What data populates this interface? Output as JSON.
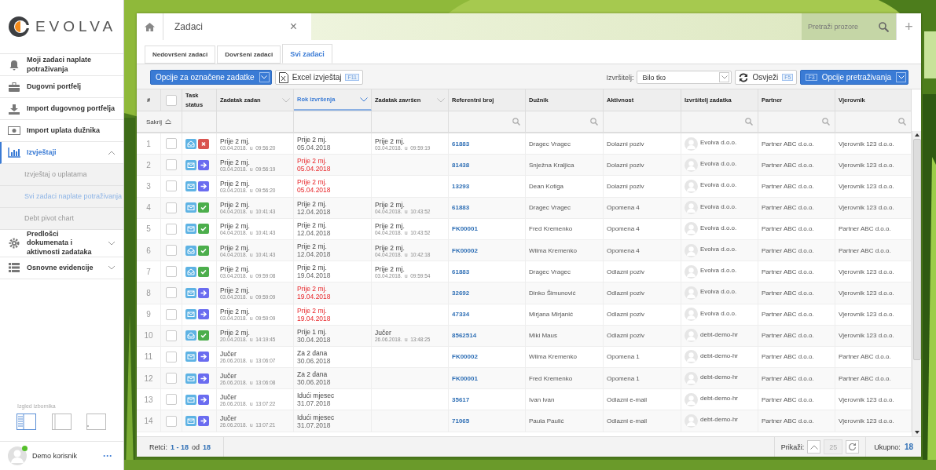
{
  "sidebar": {
    "logo": "EVOLVA",
    "items": [
      {
        "label": "Moji zadaci naplate potraživanja",
        "selected": false,
        "expandable": false
      },
      {
        "label": "Dugovni portfelj",
        "selected": false,
        "expandable": false
      },
      {
        "label": "Import dugovnog portfelja",
        "selected": false,
        "expandable": false
      },
      {
        "label": "Import uplata dužnika",
        "selected": false,
        "expandable": false
      },
      {
        "label": "Izvještaji",
        "selected": true,
        "expandable": true,
        "expanded": true,
        "children": [
          {
            "label": "Izvještaj o uplatama",
            "selected": false
          },
          {
            "label": "Svi zadaci naplate potraživanja",
            "selected": true
          },
          {
            "label": "Debt pivot chart",
            "selected": false
          }
        ]
      },
      {
        "label": "Predlošci dokumenata i aktivnosti zadataka",
        "selected": false,
        "expandable": true,
        "expanded": false
      },
      {
        "label": "Osnovne evidencije",
        "selected": false,
        "expandable": true,
        "expanded": false
      }
    ],
    "layout_label": "Izgled izbornika",
    "layouts": [
      {
        "kind": "full",
        "selected": true
      },
      {
        "kind": "narrow",
        "selected": false
      },
      {
        "kind": "hidden",
        "selected": false
      }
    ],
    "user": {
      "name": "Demo korisnik",
      "online": true,
      "more": "···"
    }
  },
  "window_tab": {
    "title": "Zadaci",
    "close": "×"
  },
  "window_search": {
    "placeholder": "Pretraži prozore",
    "add": "+"
  },
  "tabs": [
    {
      "label": "Nedovršeni zadaci",
      "selected": false
    },
    {
      "label": "Dovršeni zadaci",
      "selected": false
    },
    {
      "label": "Svi zadaci",
      "selected": true
    }
  ],
  "toolbar": {
    "options_button": "Opcije za označene zadatke",
    "excel_button": "Excel izvještaj",
    "excel_key": "F11",
    "assignee_label": "Izvršitelj:",
    "assignee_value": "Bilo tko",
    "refresh_button": "Osvježi",
    "refresh_key": "F5",
    "search_key": "F3",
    "search_button": "Opcije pretraživanja"
  },
  "table": {
    "columns": [
      {
        "label": "#",
        "sortable": false,
        "sorted": false
      },
      {
        "label": "Task status",
        "sortable": false,
        "sorted": false,
        "filter": false
      },
      {
        "label": "Zadatak zadan",
        "sortable": true,
        "sorted": false,
        "filter": false
      },
      {
        "label": "Rok izvršenja",
        "sortable": true,
        "sorted": true,
        "filter": false
      },
      {
        "label": "Zadatak završen",
        "sortable": true,
        "sorted": false,
        "filter": false
      },
      {
        "label": "Referentni broj",
        "sortable": false,
        "sorted": false,
        "filter": true
      },
      {
        "label": "Dužnik",
        "sortable": false,
        "sorted": false,
        "filter": true
      },
      {
        "label": "Aktivnost",
        "sortable": false,
        "sorted": false,
        "filter": false
      },
      {
        "label": "Izvršitelj zadatka",
        "sortable": false,
        "sorted": false,
        "filter": true
      },
      {
        "label": "Partner",
        "sortable": false,
        "sorted": false,
        "filter": true
      },
      {
        "label": "Vjerovnik",
        "sortable": false,
        "sorted": false,
        "filter": true
      }
    ],
    "select_all_checked": false,
    "hide_filters": "Sakrij",
    "rows": [
      {
        "n": "1",
        "checked": false,
        "read": true,
        "kind": "cancelled",
        "assigned": [
          "Prije 2 mj.",
          "03.04.2018.  u  09:56:20"
        ],
        "due": [
          "Prije 2 mj.",
          "05.04.2018"
        ],
        "overdue": false,
        "done": [
          "Prije 2 mj.",
          "03.04.2018.  u  09:59:19"
        ],
        "ref": "61883",
        "debtor": "Dragec Vragec",
        "activity": "Dolazni poziv",
        "assignee": "Evolva d.o.o.",
        "partner": "Partner ABC d.o.o.",
        "creditor": "Vjerovnik 123 d.o.o."
      },
      {
        "n": "2",
        "checked": false,
        "read": false,
        "kind": "pending",
        "assigned": [
          "Prije 2 mj.",
          "03.04.2018.  u  09:56:19"
        ],
        "due": [
          "Prije 2 mj.",
          "05.04.2018"
        ],
        "overdue": true,
        "ref": "81438",
        "debtor": "Snježna Kraljica",
        "activity": "Dolazni poziv",
        "assignee": "Evolva d.o.o.",
        "partner": "Partner ABC d.o.o.",
        "creditor": "Vjerovnik 123 d.o.o."
      },
      {
        "n": "3",
        "checked": false,
        "read": false,
        "kind": "pending",
        "assigned": [
          "Prije 2 mj.",
          "03.04.2018.  u  09:56:20"
        ],
        "due": [
          "Prije 2 mj.",
          "05.04.2018"
        ],
        "overdue": true,
        "ref": "13293",
        "debtor": "Dean Kotiga",
        "activity": "Dolazni poziv",
        "assignee": "Evolva d.o.o.",
        "partner": "Partner ABC d.o.o.",
        "creditor": "Vjerovnik 123 d.o.o."
      },
      {
        "n": "4",
        "checked": false,
        "read": false,
        "kind": "done",
        "assigned": [
          "Prije 2 mj.",
          "04.04.2018.  u  10:41:43"
        ],
        "due": [
          "Prije 2 mj.",
          "12.04.2018"
        ],
        "overdue": false,
        "done": [
          "Prije 2 mj.",
          "04.04.2018.  u  10:43:52"
        ],
        "ref": "61883",
        "debtor": "Dragec Vragec",
        "activity": "Opomena 4",
        "assignee": "Evolva d.o.o.",
        "partner": "Partner ABC d.o.o.",
        "creditor": "Vjerovnik 123 d.o.o."
      },
      {
        "n": "5",
        "checked": false,
        "read": false,
        "kind": "done",
        "assigned": [
          "Prije 2 mj.",
          "04.04.2018.  u  10:41:43"
        ],
        "due": [
          "Prije 2 mj.",
          "12.04.2018"
        ],
        "overdue": false,
        "done": [
          "Prije 2 mj.",
          "04.04.2018.  u  10:43:52"
        ],
        "ref": "FK00001",
        "debtor": "Fred Kremenko",
        "activity": "Opomena 4",
        "assignee": "Evolva d.o.o.",
        "partner": "Partner ABC d.o.o.",
        "creditor": "Partner ABC d.o.o."
      },
      {
        "n": "6",
        "checked": false,
        "read": true,
        "kind": "done",
        "assigned": [
          "Prije 2 mj.",
          "04.04.2018.  u  10:41:43"
        ],
        "due": [
          "Prije 2 mj.",
          "12.04.2018"
        ],
        "overdue": false,
        "done": [
          "Prije 2 mj.",
          "04.04.2018.  u  10:42:18"
        ],
        "ref": "FK00002",
        "debtor": "Wilma Kremenko",
        "activity": "Opomena 4",
        "assignee": "Evolva d.o.o.",
        "partner": "Partner ABC d.o.o.",
        "creditor": "Partner ABC d.o.o."
      },
      {
        "n": "7",
        "checked": false,
        "read": true,
        "kind": "done",
        "assigned": [
          "Prije 2 mj.",
          "03.04.2018.  u  09:59:08"
        ],
        "due": [
          "Prije 2 mj.",
          "19.04.2018"
        ],
        "overdue": false,
        "done": [
          "Prije 2 mj.",
          "03.04.2018.  u  09:59:54"
        ],
        "ref": "61883",
        "debtor": "Dragec Vragec",
        "activity": "Odlazni poziv",
        "assignee": "Evolva d.o.o.",
        "partner": "Partner ABC d.o.o.",
        "creditor": "Vjerovnik 123 d.o.o."
      },
      {
        "n": "8",
        "checked": false,
        "read": false,
        "kind": "pending",
        "assigned": [
          "Prije 2 mj.",
          "03.04.2018.  u  09:59:09"
        ],
        "due": [
          "Prije 2 mj.",
          "19.04.2018"
        ],
        "overdue": true,
        "ref": "32692",
        "debtor": "Dinko Šimunović",
        "activity": "Odlazni poziv",
        "assignee": "Evolva d.o.o.",
        "partner": "Partner ABC d.o.o.",
        "creditor": "Vjerovnik 123 d.o.o."
      },
      {
        "n": "9",
        "checked": false,
        "read": false,
        "kind": "pending",
        "assigned": [
          "Prije 2 mj.",
          "03.04.2018.  u  09:59:09"
        ],
        "due": [
          "Prije 2 mj.",
          "19.04.2018"
        ],
        "overdue": true,
        "ref": "47334",
        "debtor": "Mirjana Mirjanić",
        "activity": "Odlazni poziv",
        "assignee": "Evolva d.o.o.",
        "partner": "Partner ABC d.o.o.",
        "creditor": "Vjerovnik 123 d.o.o."
      },
      {
        "n": "10",
        "checked": false,
        "read": true,
        "kind": "done",
        "assigned": [
          "Prije 2 mj.",
          "20.04.2018.  u  14:19:45"
        ],
        "due": [
          "Prije 1 mj.",
          "30.04.2018"
        ],
        "overdue": false,
        "done": [
          "Jučer",
          "26.06.2018.  u  13:48:25"
        ],
        "ref": "8562514",
        "debtor": "Miki Maus",
        "activity": "Odlazni poziv",
        "assignee": "debt-demo-hr",
        "partner": "Partner ABC d.o.o.",
        "creditor": "Vjerovnik 123 d.o.o."
      },
      {
        "n": "11",
        "checked": false,
        "read": false,
        "kind": "pending",
        "assigned": [
          "Jučer",
          "26.06.2018.  u  13:06:07"
        ],
        "due": [
          "Za 2 dana",
          "30.06.2018"
        ],
        "overdue": false,
        "ref": "FK00002",
        "debtor": "Wilma Kremenko",
        "activity": "Opomena 1",
        "assignee": "debt-demo-hr",
        "partner": "Partner ABC d.o.o.",
        "creditor": "Partner ABC d.o.o."
      },
      {
        "n": "12",
        "checked": false,
        "read": false,
        "kind": "pending",
        "assigned": [
          "Jučer",
          "26.06.2018.  u  13:06:08"
        ],
        "due": [
          "Za 2 dana",
          "30.06.2018"
        ],
        "overdue": false,
        "ref": "FK00001",
        "debtor": "Fred Kremenko",
        "activity": "Opomena 1",
        "assignee": "debt-demo-hr",
        "partner": "Partner ABC d.o.o.",
        "creditor": "Partner ABC d.o.o."
      },
      {
        "n": "13",
        "checked": false,
        "read": false,
        "kind": "pending",
        "assigned": [
          "Jučer",
          "26.06.2018.  u  13:07:22"
        ],
        "due": [
          "Idući mjesec",
          "31.07.2018"
        ],
        "overdue": false,
        "ref": "35617",
        "debtor": "Ivan Ivan",
        "activity": "Odlazni e-mail",
        "assignee": "debt-demo-hr",
        "partner": "Partner ABC d.o.o.",
        "creditor": "Vjerovnik 123 d.o.o."
      },
      {
        "n": "14",
        "checked": false,
        "read": false,
        "kind": "pending",
        "assigned": [
          "Jučer",
          "26.06.2018.  u  13:07:21"
        ],
        "due": [
          "Idući mjesec",
          "31.07.2018"
        ],
        "overdue": false,
        "ref": "71065",
        "debtor": "Paula Paulić",
        "activity": "Odlazni e-mail",
        "assignee": "debt-demo-hr",
        "partner": "Partner ABC d.o.o.",
        "creditor": "Vjerovnik 123 d.o.o."
      }
    ]
  },
  "footer": {
    "rows_label": "Retci:",
    "range": "1 - 18",
    "of": "od",
    "count": "18",
    "show_label": "Prikaži:",
    "page_size": "25",
    "total_label": "Ukupno:",
    "total": "18"
  }
}
